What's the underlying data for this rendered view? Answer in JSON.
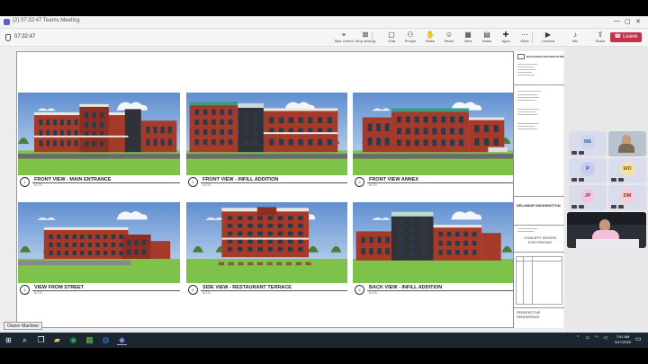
{
  "window": {
    "title": "(2) 07:32:47 Teams Meeting"
  },
  "meeting": {
    "timer": "07:32:47",
    "toolbar": [
      {
        "key": "take_control",
        "label": "Take control",
        "icon": "cursor-icon"
      },
      {
        "key": "stop_sharing",
        "label": "Stop sharing",
        "icon": "x-icon"
      },
      {
        "key": "chat",
        "label": "Chat",
        "icon": "chat-icon"
      },
      {
        "key": "people",
        "label": "People",
        "icon": "people-icon"
      },
      {
        "key": "raise",
        "label": "Raise",
        "icon": "hand-icon"
      },
      {
        "key": "react",
        "label": "React",
        "icon": "smile-icon"
      },
      {
        "key": "view",
        "label": "View",
        "icon": "grid-icon"
      },
      {
        "key": "notes",
        "label": "Notes",
        "icon": "notes-icon"
      },
      {
        "key": "apps",
        "label": "Apps",
        "icon": "apps-icon"
      },
      {
        "key": "more",
        "label": "More",
        "icon": "more-icon"
      },
      {
        "key": "camera",
        "label": "Camera",
        "icon": "camera-icon"
      },
      {
        "key": "mic",
        "label": "Mic",
        "icon": "mic-icon"
      },
      {
        "key": "share",
        "label": "Share",
        "icon": "share-icon"
      }
    ],
    "leave_label": "Leave"
  },
  "drawing": {
    "views": [
      {
        "num": "1",
        "label": "FRONT VIEW - MAIN ENTRANCE",
        "scale": "N.T.S."
      },
      {
        "num": "2",
        "label": "FRONT VIEW - INFILL ADDITION",
        "scale": "N.T.S."
      },
      {
        "num": "3",
        "label": "FRONT VIEW ANNEX",
        "scale": "N.T.S."
      },
      {
        "num": "4",
        "label": "VIEW FROM STREET",
        "scale": "N.T.S."
      },
      {
        "num": "5",
        "label": "SIDE VIEW - RESTAURANT TERRACE",
        "scale": "N.T.S."
      },
      {
        "num": "6",
        "label": "BACK VIEW - INFILL ADDITION",
        "scale": "N.T.S."
      }
    ],
    "titleblock": {
      "firm": "BUCHANAN ARCHITECTURE",
      "project": "DELAMAR WASHINGTON",
      "phase": "CONCEPT DESIGN FOR PRICING",
      "sheet_title": "PERSPECTIVE RENDERINGS"
    }
  },
  "participants": [
    {
      "initials": "NS",
      "bg": "#c7d6f0",
      "fg": "#2f4d8a"
    },
    {
      "initials": "P",
      "bg": "#c6ccef",
      "fg": "#33409a"
    },
    {
      "initials": "WD",
      "bg": "#f3e3a9",
      "fg": "#7a5a06"
    },
    {
      "initials": "JP",
      "bg": "#f0c9e0",
      "fg": "#8a2a63"
    },
    {
      "initials": "DM",
      "bg": "#f4cfd3",
      "fg": "#8a2a33"
    }
  ],
  "taskbar": {
    "tooltip": "Owner Machine",
    "time": "7:51 AM",
    "date": "9/17/2025"
  }
}
